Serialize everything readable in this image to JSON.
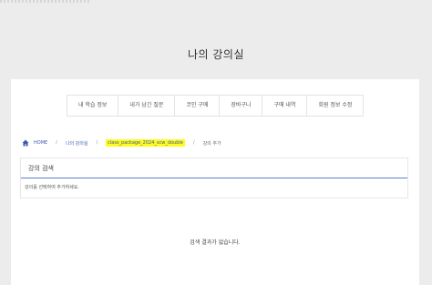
{
  "page": {
    "title": "나의 강의실"
  },
  "tabs": [
    {
      "label": "내 학습 정보"
    },
    {
      "label": "내가 남긴 질문"
    },
    {
      "label": "코인 구매"
    },
    {
      "label": "장바구니"
    },
    {
      "label": "구매 내역"
    },
    {
      "label": "회원 정보 수정"
    }
  ],
  "breadcrumb": {
    "home": "HOME",
    "classroom": "나의 강의실",
    "package": "class_package_2024_scw_double",
    "current": "강의 추가",
    "separator": "/"
  },
  "search": {
    "heading": "강의 검색",
    "hint": "강의를 선택하여 추가하세요."
  },
  "results": {
    "empty_message": "검색 결과가 없습니다."
  },
  "colors": {
    "highlight": "#fffb1f",
    "link": "#3a5bb0",
    "accent_line": "#5b7fd0"
  }
}
